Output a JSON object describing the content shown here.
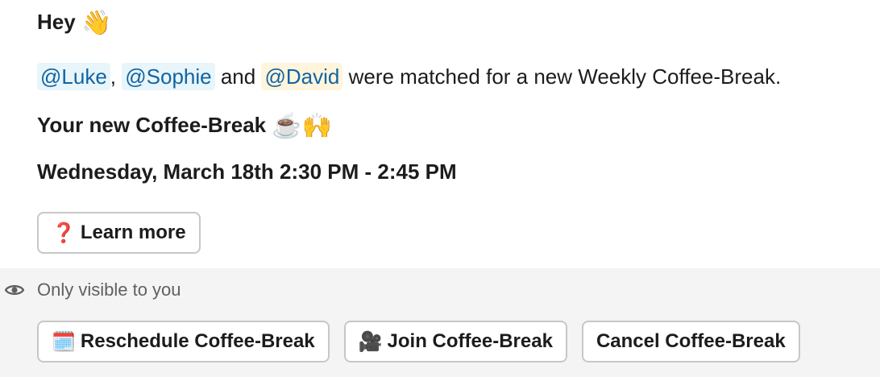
{
  "message": {
    "greeting": "Hey",
    "greeting_emoji": "👋",
    "mentions": [
      "@Luke",
      "@Sophie",
      "@David"
    ],
    "separator_comma": ",",
    "separator_and": "and",
    "matched_text": "were matched for a new Weekly Coffee-Break.",
    "new_break_label": "Your new Coffee-Break",
    "coffee_emoji": "☕",
    "raised_hands_emoji": "🙌",
    "datetime": "Wednesday, March 18th 2:30 PM - 2:45 PM"
  },
  "learn_more": {
    "icon": "❓",
    "label": "Learn more"
  },
  "ephemeral": {
    "visibility_icon": "eye-icon",
    "visibility_text": "Only visible to you",
    "actions": [
      {
        "icon": "🗓️",
        "label": "Reschedule Coffee-Break"
      },
      {
        "icon": "🎥",
        "label": "Join Coffee-Break"
      },
      {
        "label": "Cancel Coffee-Break"
      }
    ]
  },
  "colors": {
    "mention_text": "#1264a3",
    "mention_bg_blue": "#e8f5fa",
    "mention_bg_yellow": "#fef5dc",
    "ephemeral_bg": "#f4f4f4"
  }
}
